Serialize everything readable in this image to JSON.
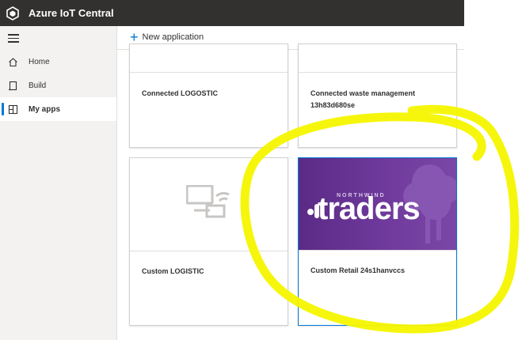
{
  "topbar": {
    "title": "Azure IoT Central"
  },
  "sidebar": {
    "items": [
      {
        "label": "Home",
        "icon": "home-icon"
      },
      {
        "label": "Build",
        "icon": "build-icon"
      },
      {
        "label": "My apps",
        "icon": "apps-icon",
        "active": true
      }
    ]
  },
  "commandbar": {
    "new_app_label": "New application"
  },
  "apps": [
    {
      "name": "Connected LOGOSTIC"
    },
    {
      "name_line1": "Connected waste management",
      "name_line2": "13h83d680se"
    },
    {
      "name": "Custom LOGISTIC",
      "thumbnail": "default-app-icon"
    },
    {
      "name": "Custom Retail 24s1hanvccs",
      "thumbnail": "northwind-traders-logo",
      "logo_sub": "NORTHWIND",
      "logo_main": "traders"
    }
  ],
  "colors": {
    "accent": "#0078d4",
    "topbar": "#323130",
    "highlight": "#f5f500",
    "tile_purple": "#5b2a86"
  }
}
